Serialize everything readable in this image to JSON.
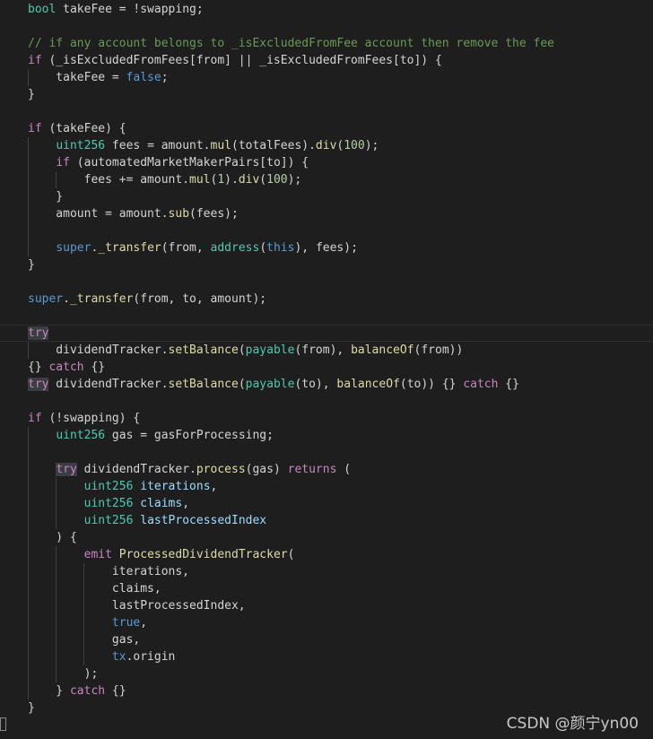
{
  "code_lines": [
    {
      "segments": [
        {
          "t": "bool",
          "c": "ty"
        },
        {
          "t": " takeFee = !swapping;",
          "c": "pl"
        }
      ]
    },
    {
      "segments": []
    },
    {
      "segments": [
        {
          "t": "// if any account belongs to _isExcludedFromFee account then remove the fee",
          "c": "cm"
        }
      ]
    },
    {
      "segments": [
        {
          "t": "if",
          "c": "kw"
        },
        {
          "t": " (_isExcludedFromFees[from] || _isExcludedFromFees[to]) {",
          "c": "pl"
        }
      ]
    },
    {
      "segments": [
        {
          "t": "    takeFee = ",
          "c": "pl"
        },
        {
          "t": "false",
          "c": "bl"
        },
        {
          "t": ";",
          "c": "pl"
        }
      ]
    },
    {
      "segments": [
        {
          "t": "}",
          "c": "pl"
        }
      ]
    },
    {
      "segments": []
    },
    {
      "segments": [
        {
          "t": "if",
          "c": "kw"
        },
        {
          "t": " (takeFee) {",
          "c": "pl"
        }
      ]
    },
    {
      "segments": [
        {
          "t": "    ",
          "c": "pl"
        },
        {
          "t": "uint256",
          "c": "ty"
        },
        {
          "t": " fees = amount.",
          "c": "pl"
        },
        {
          "t": "mul",
          "c": "fn"
        },
        {
          "t": "(totalFees).",
          "c": "pl"
        },
        {
          "t": "div",
          "c": "fn"
        },
        {
          "t": "(",
          "c": "pl"
        },
        {
          "t": "100",
          "c": "nm"
        },
        {
          "t": ");",
          "c": "pl"
        }
      ]
    },
    {
      "segments": [
        {
          "t": "    ",
          "c": "pl"
        },
        {
          "t": "if",
          "c": "kw"
        },
        {
          "t": " (automatedMarketMakerPairs[to]) {",
          "c": "pl"
        }
      ]
    },
    {
      "segments": [
        {
          "t": "        fees += amount.",
          "c": "pl"
        },
        {
          "t": "mul",
          "c": "fn"
        },
        {
          "t": "(",
          "c": "pl"
        },
        {
          "t": "1",
          "c": "nm"
        },
        {
          "t": ").",
          "c": "pl"
        },
        {
          "t": "div",
          "c": "fn"
        },
        {
          "t": "(",
          "c": "pl"
        },
        {
          "t": "100",
          "c": "nm"
        },
        {
          "t": ");",
          "c": "pl"
        }
      ]
    },
    {
      "segments": [
        {
          "t": "    }",
          "c": "pl"
        }
      ]
    },
    {
      "segments": [
        {
          "t": "    amount = amount.",
          "c": "pl"
        },
        {
          "t": "sub",
          "c": "fn"
        },
        {
          "t": "(fees);",
          "c": "pl"
        }
      ]
    },
    {
      "segments": []
    },
    {
      "segments": [
        {
          "t": "    ",
          "c": "pl"
        },
        {
          "t": "super",
          "c": "bl"
        },
        {
          "t": ".",
          "c": "pl"
        },
        {
          "t": "_transfer",
          "c": "fn"
        },
        {
          "t": "(from, ",
          "c": "pl"
        },
        {
          "t": "address",
          "c": "ty"
        },
        {
          "t": "(",
          "c": "pl"
        },
        {
          "t": "this",
          "c": "bl"
        },
        {
          "t": "), fees);",
          "c": "pl"
        }
      ]
    },
    {
      "segments": [
        {
          "t": "}",
          "c": "pl"
        }
      ]
    },
    {
      "segments": []
    },
    {
      "segments": [
        {
          "t": "super",
          "c": "bl"
        },
        {
          "t": ".",
          "c": "pl"
        },
        {
          "t": "_transfer",
          "c": "fn"
        },
        {
          "t": "(from, to, amount);",
          "c": "pl"
        }
      ]
    },
    {
      "segments": []
    },
    {
      "segments": [
        {
          "t": "try",
          "c": "kw",
          "hl": true
        }
      ]
    },
    {
      "segments": [
        {
          "t": "    dividendTracker.",
          "c": "pl"
        },
        {
          "t": "setBalance",
          "c": "fn"
        },
        {
          "t": "(",
          "c": "pl"
        },
        {
          "t": "payable",
          "c": "ty"
        },
        {
          "t": "(from), ",
          "c": "pl"
        },
        {
          "t": "balanceOf",
          "c": "fn"
        },
        {
          "t": "(from))",
          "c": "pl"
        }
      ]
    },
    {
      "segments": [
        {
          "t": "{} ",
          "c": "pl"
        },
        {
          "t": "catch",
          "c": "kw"
        },
        {
          "t": " {}",
          "c": "pl"
        }
      ]
    },
    {
      "segments": [
        {
          "t": "try",
          "c": "kw",
          "hl": true
        },
        {
          "t": " dividendTracker.",
          "c": "pl"
        },
        {
          "t": "setBalance",
          "c": "fn"
        },
        {
          "t": "(",
          "c": "pl"
        },
        {
          "t": "payable",
          "c": "ty"
        },
        {
          "t": "(to), ",
          "c": "pl"
        },
        {
          "t": "balanceOf",
          "c": "fn"
        },
        {
          "t": "(to)) {} ",
          "c": "pl"
        },
        {
          "t": "catch",
          "c": "kw"
        },
        {
          "t": " {}",
          "c": "pl"
        }
      ]
    },
    {
      "segments": []
    },
    {
      "segments": [
        {
          "t": "if",
          "c": "kw"
        },
        {
          "t": " (!swapping) {",
          "c": "pl"
        }
      ]
    },
    {
      "segments": [
        {
          "t": "    ",
          "c": "pl"
        },
        {
          "t": "uint256",
          "c": "ty"
        },
        {
          "t": " gas = gasForProcessing;",
          "c": "pl"
        }
      ]
    },
    {
      "segments": []
    },
    {
      "segments": [
        {
          "t": "    ",
          "c": "pl"
        },
        {
          "t": "try",
          "c": "kw",
          "hl": true
        },
        {
          "t": " dividendTracker.",
          "c": "pl"
        },
        {
          "t": "process",
          "c": "fn"
        },
        {
          "t": "(gas) ",
          "c": "pl"
        },
        {
          "t": "returns",
          "c": "kw"
        },
        {
          "t": " (",
          "c": "pl"
        }
      ]
    },
    {
      "segments": [
        {
          "t": "        ",
          "c": "pl"
        },
        {
          "t": "uint256",
          "c": "ty"
        },
        {
          "t": " iterations",
          "c": "vr"
        },
        {
          "t": ",",
          "c": "pl"
        }
      ]
    },
    {
      "segments": [
        {
          "t": "        ",
          "c": "pl"
        },
        {
          "t": "uint256",
          "c": "ty"
        },
        {
          "t": " claims",
          "c": "vr"
        },
        {
          "t": ",",
          "c": "pl"
        }
      ]
    },
    {
      "segments": [
        {
          "t": "        ",
          "c": "pl"
        },
        {
          "t": "uint256",
          "c": "ty"
        },
        {
          "t": " lastProcessedIndex",
          "c": "vr"
        }
      ]
    },
    {
      "segments": [
        {
          "t": "    ) {",
          "c": "pl"
        }
      ]
    },
    {
      "segments": [
        {
          "t": "        ",
          "c": "pl"
        },
        {
          "t": "emit",
          "c": "kw"
        },
        {
          "t": " ",
          "c": "pl"
        },
        {
          "t": "ProcessedDividendTracker",
          "c": "fn"
        },
        {
          "t": "(",
          "c": "pl"
        }
      ]
    },
    {
      "segments": [
        {
          "t": "            iterations,",
          "c": "pl"
        }
      ]
    },
    {
      "segments": [
        {
          "t": "            claims,",
          "c": "pl"
        }
      ]
    },
    {
      "segments": [
        {
          "t": "            lastProcessedIndex,",
          "c": "pl"
        }
      ]
    },
    {
      "segments": [
        {
          "t": "            ",
          "c": "pl"
        },
        {
          "t": "true",
          "c": "bl"
        },
        {
          "t": ",",
          "c": "pl"
        }
      ]
    },
    {
      "segments": [
        {
          "t": "            gas,",
          "c": "pl"
        }
      ]
    },
    {
      "segments": [
        {
          "t": "            ",
          "c": "pl"
        },
        {
          "t": "tx",
          "c": "bl"
        },
        {
          "t": ".origin",
          "c": "pl"
        }
      ]
    },
    {
      "segments": [
        {
          "t": "        );",
          "c": "pl"
        }
      ]
    },
    {
      "segments": [
        {
          "t": "    } ",
          "c": "pl"
        },
        {
          "t": "catch",
          "c": "kw"
        },
        {
          "t": " {}",
          "c": "pl"
        }
      ]
    },
    {
      "segments": [
        {
          "t": "}",
          "c": "pl"
        }
      ]
    }
  ],
  "watermark": "CSDN @颜宁yn00",
  "colors": {
    "background": "#1e1e1e",
    "keyword": "#c586c0",
    "type": "#4ec9b0",
    "function": "#dcdcaa",
    "number": "#b5cea8",
    "comment": "#6a9955",
    "literal": "#569cd6",
    "variable": "#9cdcfe",
    "plain": "#d4d4d4"
  }
}
